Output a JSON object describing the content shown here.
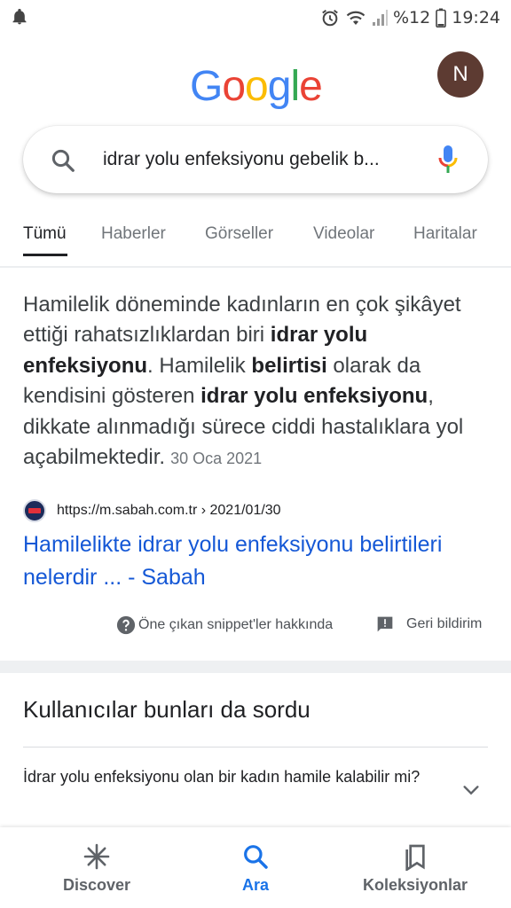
{
  "status_bar": {
    "battery": "%12",
    "time": "19:24",
    "icons": [
      "bell-icon",
      "alarm-icon",
      "wifi-icon",
      "signal-icon",
      "battery-icon"
    ]
  },
  "header": {
    "logo_letters": [
      {
        "char": "G",
        "color": "#4285F4"
      },
      {
        "char": "o",
        "color": "#EA4335"
      },
      {
        "char": "o",
        "color": "#FBBC05"
      },
      {
        "char": "g",
        "color": "#4285F4"
      },
      {
        "char": "l",
        "color": "#34A853"
      },
      {
        "char": "e",
        "color": "#EA4335"
      }
    ],
    "avatar_initial": "N",
    "avatar_color": "#5d3b32"
  },
  "search": {
    "query": "idrar yolu enfeksiyonu gebelik b..."
  },
  "tabs": [
    {
      "label": "Tümü",
      "active": true
    },
    {
      "label": "Haberler",
      "active": false
    },
    {
      "label": "Görseller",
      "active": false
    },
    {
      "label": "Videolar",
      "active": false
    },
    {
      "label": "Haritalar",
      "active": false
    }
  ],
  "featured_snippet": {
    "segments": [
      {
        "text": "Hamilelik döneminde kadınların en çok şikâyet ettiği rahatsızlıklardan biri ",
        "bold": false
      },
      {
        "text": "idrar yolu enfeksiyonu",
        "bold": true
      },
      {
        "text": ". Hamilelik ",
        "bold": false
      },
      {
        "text": "belirtisi",
        "bold": true
      },
      {
        "text": " olarak da kendisini gösteren ",
        "bold": false
      },
      {
        "text": "idrar yolu enfeksiyonu",
        "bold": true
      },
      {
        "text": ", dikkate alınmadığı sürece ciddi hastalıklara yol açabilmektedir.",
        "bold": false
      }
    ],
    "date": "30 Oca 2021",
    "source_url": "https://m.sabah.com.tr › 2021/01/30",
    "title": "Hamilelikte idrar yolu enfeksiyonu belirtileri nelerdir ... - Sabah",
    "about_label": "Öne çıkan snippet'ler hakkında",
    "feedback_label": "Geri bildirim"
  },
  "people_also_ask": {
    "title": "Kullanıcılar bunları da sordu",
    "questions": [
      "İdrar yolu enfeksiyonu olan bir kadın hamile kalabilir mi?"
    ]
  },
  "bottom_nav": [
    {
      "label": "Discover",
      "icon": "discover-icon",
      "active": false
    },
    {
      "label": "Ara",
      "icon": "search-icon",
      "active": true
    },
    {
      "label": "Koleksiyonlar",
      "icon": "collections-icon",
      "active": false
    }
  ],
  "colors": {
    "link": "#1558d6",
    "active_nav": "#1a73e8"
  }
}
